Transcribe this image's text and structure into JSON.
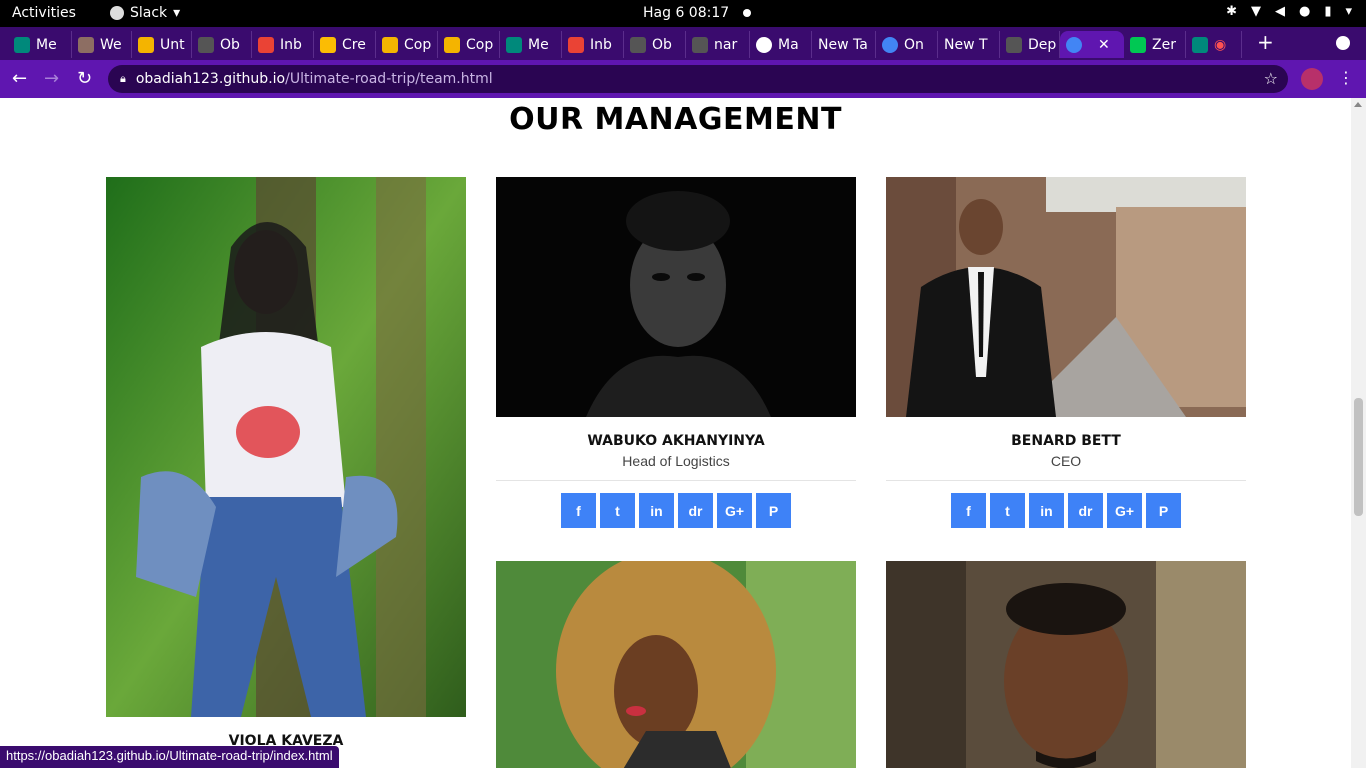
{
  "system_bar": {
    "activities": "Activities",
    "app_name": "Slack",
    "clock": "Hag 6  08:17"
  },
  "tabs": [
    {
      "label": "Me",
      "color": "#00897b"
    },
    {
      "label": "We",
      "color": "#8d6e63"
    },
    {
      "label": "Unt",
      "color": "#f4b400"
    },
    {
      "label": "Ob",
      "color": "#555555"
    },
    {
      "label": "Inb",
      "color": "#ea4335"
    },
    {
      "label": "Cre",
      "color": "#fbbc04"
    },
    {
      "label": "Cop",
      "color": "#f4b400"
    },
    {
      "label": "Cop",
      "color": "#f4b400"
    },
    {
      "label": "Me",
      "color": "#00897b"
    },
    {
      "label": "Inb",
      "color": "#ea4335"
    },
    {
      "label": "Ob",
      "color": "#555555"
    },
    {
      "label": "nar",
      "color": "#555555"
    },
    {
      "label": "Ma",
      "color": "#ffffff"
    },
    {
      "label": "New Ta",
      "color": ""
    },
    {
      "label": "On",
      "color": "#4285f4"
    },
    {
      "label": "New T",
      "color": ""
    },
    {
      "label": "Dep",
      "color": "#555555"
    },
    {
      "label": "",
      "color": "#4285f4",
      "active": true
    },
    {
      "label": "Zer",
      "color": "#00c853"
    },
    {
      "label": "",
      "color": "#00897b"
    }
  ],
  "address_bar": {
    "host": "obadiah123.github.io",
    "path": "/Ultimate-road-trip/team.html"
  },
  "page": {
    "heading": "OUR MANAGEMENT",
    "members": [
      {
        "name": "VIOLA KAVEZA",
        "role": ""
      },
      {
        "name": "WABUKO AKHANYINYA",
        "role": "Head of Logistics"
      },
      {
        "name": "BENARD BETT",
        "role": "CEO"
      },
      {
        "name": "",
        "role": ""
      },
      {
        "name": "",
        "role": ""
      }
    ],
    "social_labels": [
      "f",
      "t",
      "in",
      "dr",
      "G+",
      "P"
    ]
  },
  "status_url": "https://obadiah123.github.io/Ultimate-road-trip/index.html"
}
